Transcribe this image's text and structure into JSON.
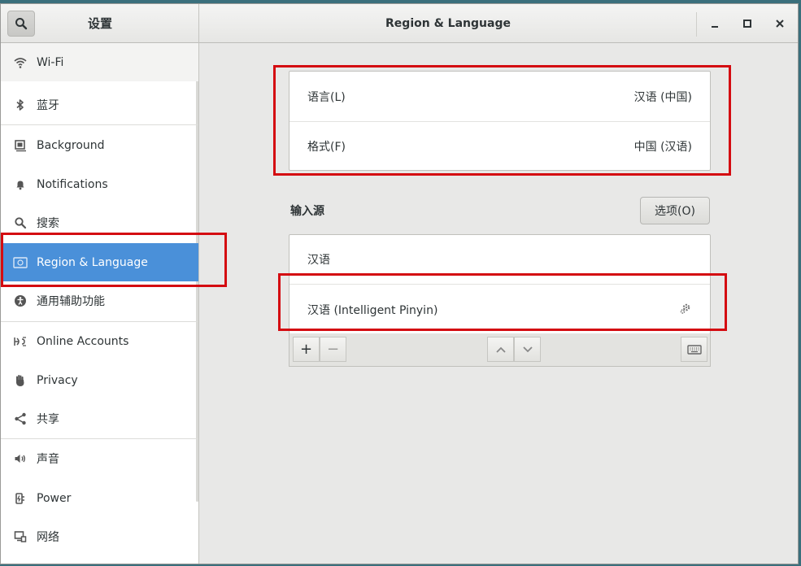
{
  "header": {
    "sidebar_title": "设置",
    "title": "Region & Language",
    "icons": {
      "search": "search-icon",
      "minimize": "minimize-icon",
      "maximize": "maximize-icon",
      "close": "close-icon"
    }
  },
  "sidebar": {
    "items": [
      {
        "label": "Wi-Fi",
        "icon": "wifi-icon"
      },
      {
        "label": "蓝牙",
        "icon": "bluetooth-icon"
      },
      {
        "label": "Background",
        "icon": "background-icon"
      },
      {
        "label": "Notifications",
        "icon": "bell-icon"
      },
      {
        "label": "搜索",
        "icon": "search-icon"
      },
      {
        "label": "Region & Language",
        "icon": "region-language-icon",
        "selected": true
      },
      {
        "label": "通用辅助功能",
        "icon": "accessibility-icon"
      },
      {
        "label": "Online Accounts",
        "icon": "online-accounts-icon"
      },
      {
        "label": "Privacy",
        "icon": "privacy-hand-icon"
      },
      {
        "label": "共享",
        "icon": "share-icon"
      },
      {
        "label": "声音",
        "icon": "speaker-icon"
      },
      {
        "label": "Power",
        "icon": "power-plug-icon"
      },
      {
        "label": "网络",
        "icon": "network-icon"
      }
    ]
  },
  "locale": {
    "language_label": "语言(L)",
    "language_value": "汉语 (中国)",
    "formats_label": "格式(F)",
    "formats_value": "中国 (汉语)"
  },
  "input_sources": {
    "heading": "输入源",
    "options_button": "选项(O)",
    "sources": [
      {
        "label": "汉语"
      },
      {
        "label": "汉语 (Intelligent Pinyin)",
        "has_settings": true
      }
    ],
    "toolbar": {
      "add": "+",
      "remove": "−",
      "icons": [
        "add-icon",
        "remove-icon",
        "move-up-icon",
        "move-down-icon",
        "keyboard-icon"
      ]
    }
  },
  "colors": {
    "selection": "#4a90d9",
    "highlight_box": "#d40b11"
  }
}
